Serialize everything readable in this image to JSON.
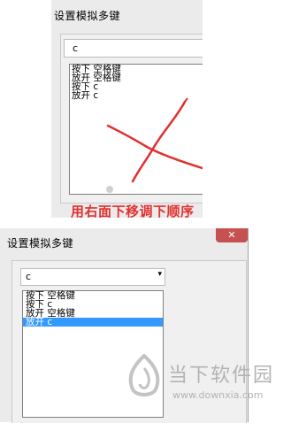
{
  "top_dialog": {
    "title": "设置模拟多键",
    "combo_value": "c",
    "list_items": [
      "按下 空格键",
      "放开 空格键",
      "按下 c",
      "放开 c"
    ]
  },
  "caption": "用右面下移调下顺序",
  "bottom_dialog": {
    "title": "设置模拟多键",
    "close_symbol": "✕",
    "combo_value": "c",
    "combo_arrow": "▾",
    "list_items": [
      "按下 空格键",
      "按下 c",
      "放开 空格键",
      "放开 c"
    ],
    "selected_index": 3
  },
  "watermark": {
    "name": "当下软件园",
    "url": "www.downxia.com"
  },
  "colors": {
    "annotation_red": "#e0312f",
    "selection_blue": "#3399ff",
    "close_red": "#c75050"
  },
  "icons": {
    "close": "close-icon",
    "dropdown": "chevron-down-icon",
    "watermark_logo": "downxia-logo-icon"
  }
}
